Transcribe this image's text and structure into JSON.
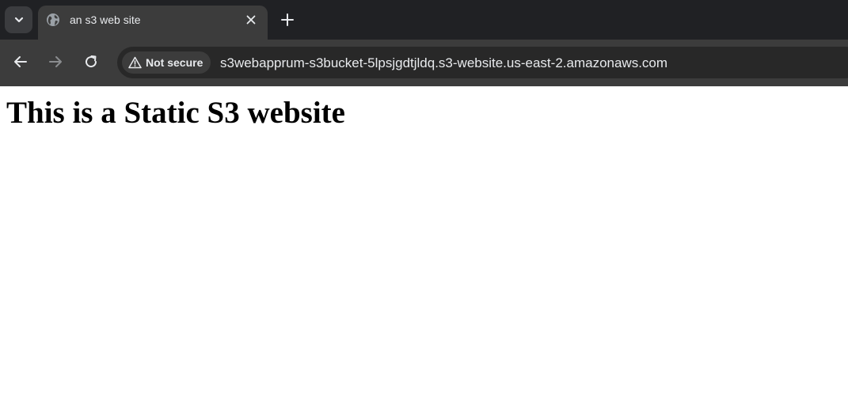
{
  "browser": {
    "tab": {
      "title": "an s3 web site",
      "favicon": "globe-icon",
      "close_icon": "close-icon"
    },
    "tab_search_icon": "chevron-down-icon",
    "new_tab_icon": "plus-icon",
    "nav": {
      "back_icon": "arrow-left-icon",
      "forward_icon": "arrow-right-icon",
      "reload_icon": "reload-icon"
    },
    "omnibox": {
      "security_icon": "warning-icon",
      "security_label": "Not secure",
      "url": "s3webapprum-s3bucket-5lpsjgdtjldq.s3-website.us-east-2.amazonaws.com"
    },
    "colors": {
      "frame": "#202124",
      "toolbar": "#3c3c3c",
      "omnibox": "#282828",
      "text": "#e8eaed"
    }
  },
  "page": {
    "heading": "This is a Static S3 website"
  }
}
